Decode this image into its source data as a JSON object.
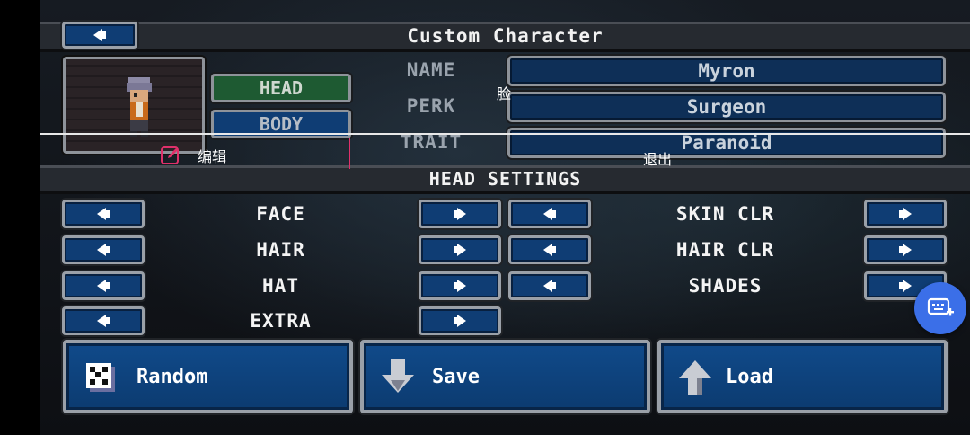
{
  "header": {
    "title": "Custom Character",
    "back_icon": "left-arrow-icon"
  },
  "tabs": [
    {
      "label": "HEAD",
      "active": true,
      "color": "#1e5a32"
    },
    {
      "label": "BODY",
      "active": false,
      "color": "#0f3d74"
    }
  ],
  "info": {
    "rows": [
      {
        "label": "NAME",
        "value": "Myron"
      },
      {
        "label": "PERK",
        "value": "Surgeon"
      },
      {
        "label": "TRAIT",
        "value": "Paranoid"
      }
    ]
  },
  "section": {
    "title": "HEAD SETTINGS"
  },
  "left_settings": [
    "FACE",
    "HAIR",
    "HAT",
    "EXTRA"
  ],
  "right_settings": [
    "SKIN CLR",
    "HAIR CLR",
    "SHADES"
  ],
  "actions": {
    "random": "Random",
    "save": "Save",
    "load": "Load"
  },
  "overlay": {
    "edit": "编辑",
    "face": "脸",
    "exit": "退出"
  },
  "colors": {
    "button_blue": "#0f3d74",
    "accent_pink": "#e0306a",
    "fab": "#3b6fe8"
  }
}
